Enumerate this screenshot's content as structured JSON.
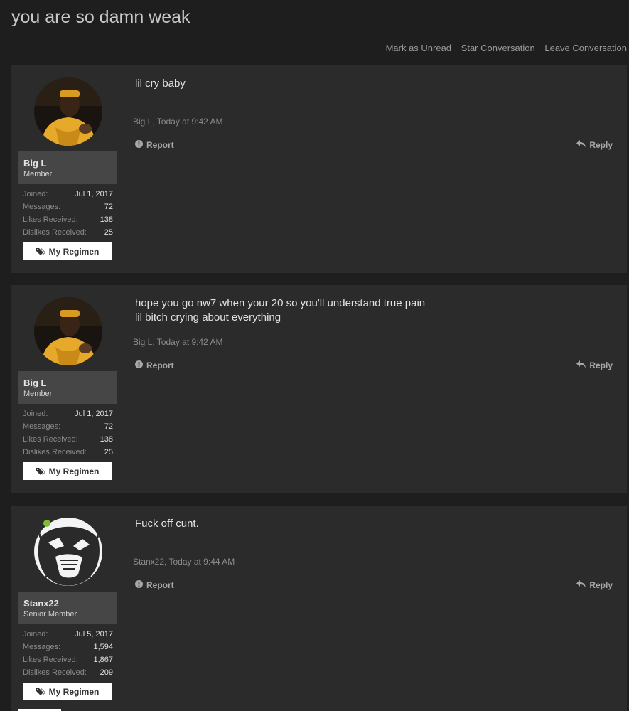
{
  "page_title": "you are so damn weak",
  "conversation_actions": [
    "Mark as Unread",
    "Star Conversation",
    "Leave Conversation"
  ],
  "labels": {
    "joined": "Joined:",
    "messages": "Messages:",
    "likes_received": "Likes Received:",
    "dislikes_received": "Dislikes Received:",
    "regimen_button": "My Regimen",
    "report": "Report",
    "reply": "Reply"
  },
  "messages": [
    {
      "username": "Big L",
      "user_title": "Member",
      "avatar": "yellow-jacket-photo",
      "online": false,
      "joined": "Jul 1, 2017",
      "message_count": "72",
      "likes_received": "138",
      "dislikes_received": "25",
      "text_lines": [
        "lil cry baby"
      ],
      "meta": "Big L, Today at 9:42 AM"
    },
    {
      "username": "Big L",
      "user_title": "Member",
      "avatar": "yellow-jacket-photo",
      "online": false,
      "joined": "Jul 1, 2017",
      "message_count": "72",
      "likes_received": "138",
      "dislikes_received": "25",
      "text_lines": [
        "hope you go nw7 when your 20 so you'll understand true pain",
        "lil bitch crying about everything"
      ],
      "meta": "Big L, Today at 9:42 AM"
    },
    {
      "username": "Stanx22",
      "user_title": "Senior Member",
      "avatar": "manga-beast-drawing",
      "online": true,
      "joined": "Jul 5, 2017",
      "message_count": "1,594",
      "likes_received": "1,867",
      "dislikes_received": "209",
      "text_lines": [
        "Fuck off cunt."
      ],
      "meta": "Stanx22, Today at 9:44 AM"
    }
  ],
  "colors": {
    "background": "#1e1e1e",
    "panel": "#2b2b2b",
    "name_box": "#464646",
    "online": "#7fbf2f"
  }
}
